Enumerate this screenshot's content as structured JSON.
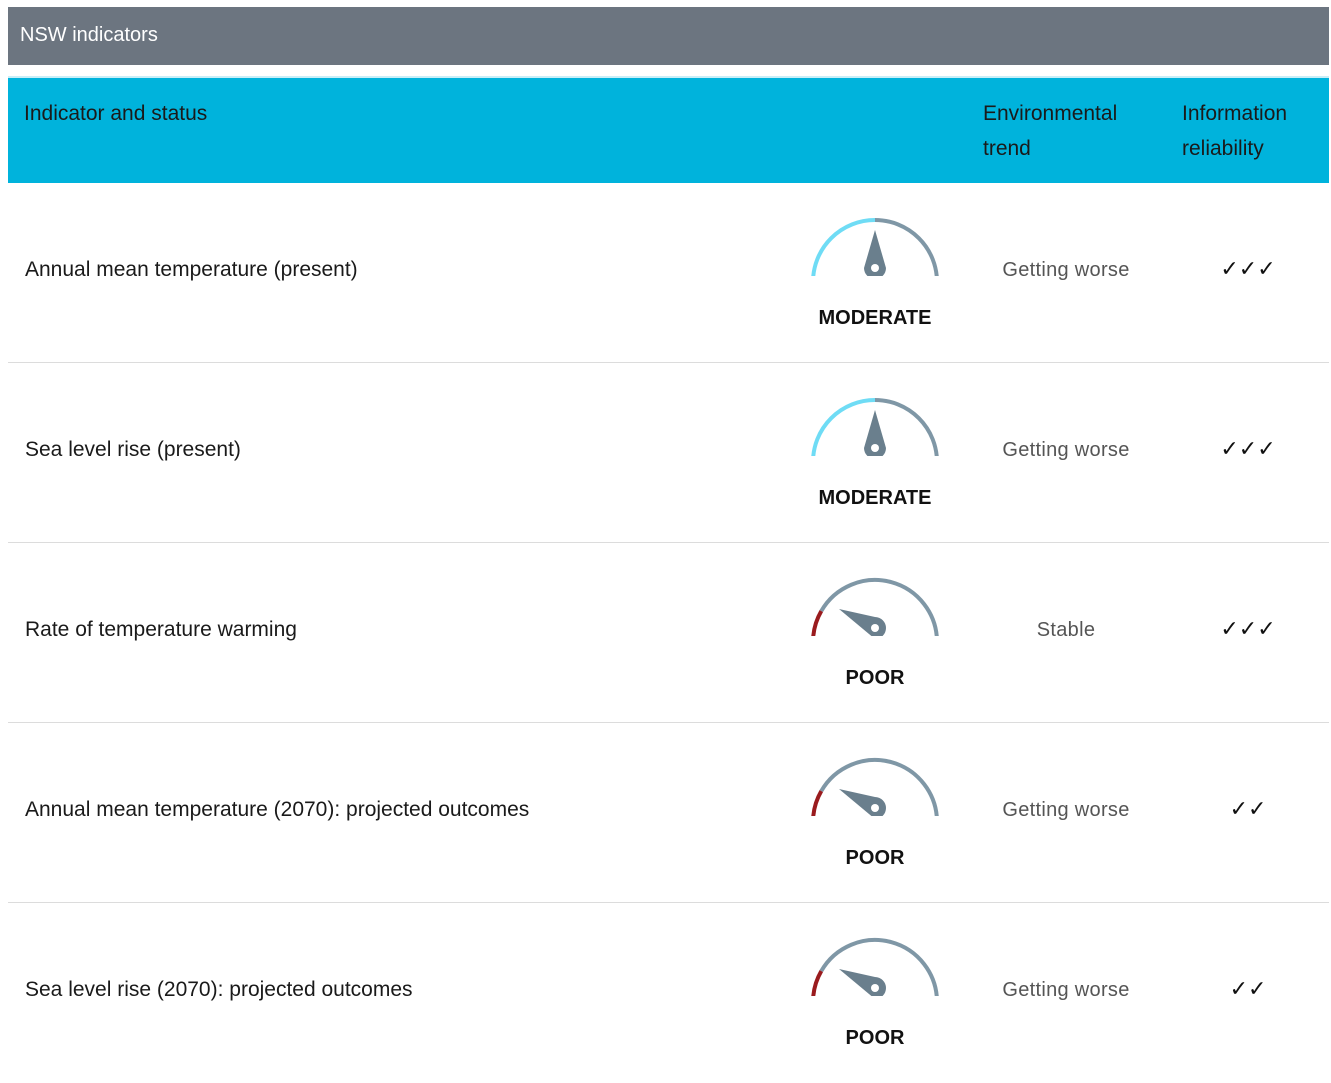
{
  "title": "NSW indicators",
  "columns": {
    "indicator": "Indicator and status",
    "trend": "Environmental trend",
    "reliability": "Information reliability"
  },
  "colors": {
    "title_bar": "#6c7580",
    "header_bar": "#00b3dc",
    "gauge_track": "#7f97a6",
    "gauge_moderate": "#6fdcf5",
    "gauge_poor": "#9a1b1e",
    "needle": "#6a7f8d"
  },
  "rows": [
    {
      "indicator": "Annual mean temperature (present)",
      "status": "MODERATE",
      "gauge_icon": "gauge-moderate-icon",
      "trend": "Getting worse",
      "reliability": "✓✓✓"
    },
    {
      "indicator": "Sea level rise (present)",
      "status": "MODERATE",
      "gauge_icon": "gauge-moderate-icon",
      "trend": "Getting worse",
      "reliability": "✓✓✓"
    },
    {
      "indicator": "Rate of temperature warming",
      "status": "POOR",
      "gauge_icon": "gauge-poor-icon",
      "trend": "Stable",
      "reliability": "✓✓✓"
    },
    {
      "indicator": "Annual mean temperature (2070): projected outcomes",
      "status": "POOR",
      "gauge_icon": "gauge-poor-icon",
      "trend": "Getting worse",
      "reliability": "✓✓"
    },
    {
      "indicator": "Sea level rise (2070): projected outcomes",
      "status": "POOR",
      "gauge_icon": "gauge-poor-icon",
      "trend": "Getting worse",
      "reliability": "✓✓"
    }
  ]
}
